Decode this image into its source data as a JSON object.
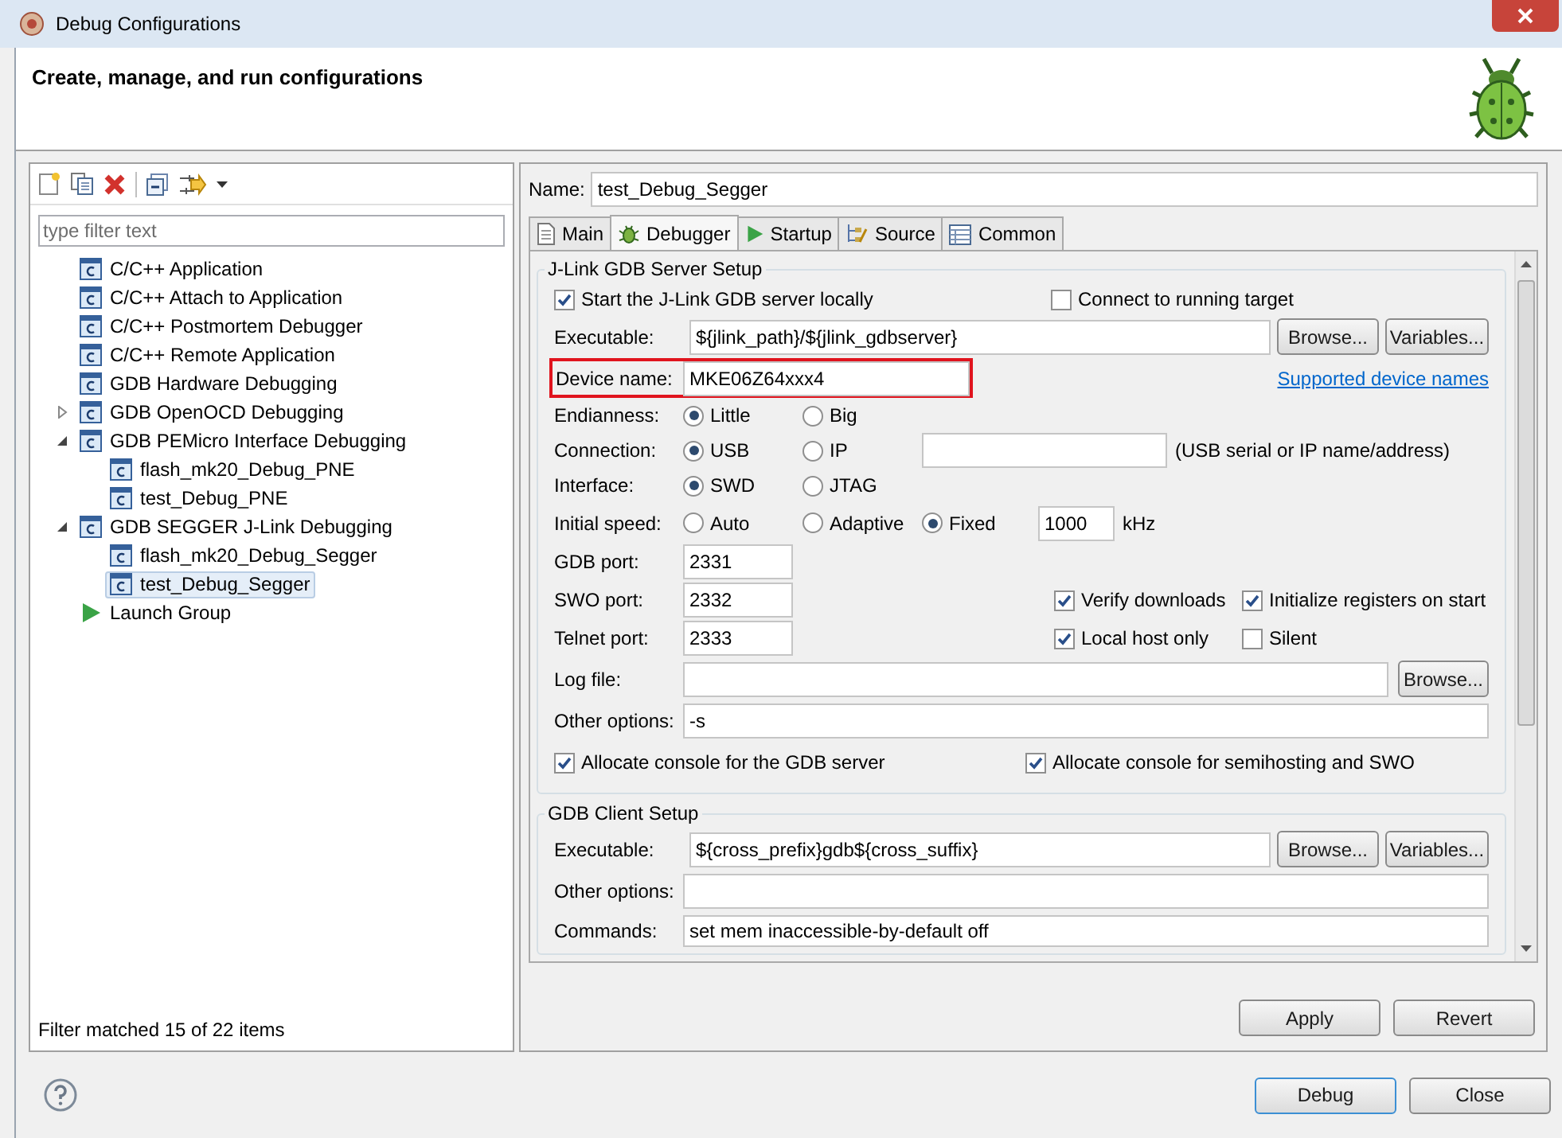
{
  "window": {
    "title": "Debug Configurations"
  },
  "header": {
    "title": "Create, manage, and run configurations"
  },
  "filter": {
    "placeholder": "type filter text"
  },
  "tree": [
    {
      "label": "C/C++ Application",
      "kind": "config",
      "selected": false
    },
    {
      "label": "C/C++ Attach to Application",
      "kind": "config",
      "selected": false
    },
    {
      "label": "C/C++ Postmortem Debugger",
      "kind": "config",
      "selected": false
    },
    {
      "label": "C/C++ Remote Application",
      "kind": "config",
      "selected": false
    },
    {
      "label": "GDB Hardware Debugging",
      "kind": "config",
      "selected": false
    },
    {
      "label": "GDB OpenOCD Debugging",
      "kind": "config",
      "selected": false,
      "expanded": false
    },
    {
      "label": "GDB PEMicro Interface Debugging",
      "kind": "config",
      "selected": false,
      "expanded": true,
      "children": [
        {
          "label": "flash_mk20_Debug_PNE",
          "kind": "config",
          "selected": false
        },
        {
          "label": "test_Debug_PNE",
          "kind": "config",
          "selected": false
        }
      ]
    },
    {
      "label": "GDB SEGGER J-Link Debugging",
      "kind": "config",
      "selected": false,
      "expanded": true,
      "children": [
        {
          "label": "flash_mk20_Debug_Segger",
          "kind": "config",
          "selected": false
        },
        {
          "label": "test_Debug_Segger",
          "kind": "config",
          "selected": true
        }
      ]
    },
    {
      "label": "Launch Group",
      "kind": "launch",
      "selected": false
    }
  ],
  "filter_status": "Filter matched 15 of 22 items",
  "name": {
    "label": "Name:",
    "value": "test_Debug_Segger"
  },
  "tabs": [
    {
      "label": "Main",
      "kind": "doc",
      "selected": false
    },
    {
      "label": "Debugger",
      "kind": "bug",
      "selected": true
    },
    {
      "label": "Startup",
      "kind": "play",
      "selected": false
    },
    {
      "label": "Source",
      "kind": "source",
      "selected": false
    },
    {
      "label": "Common",
      "kind": "table",
      "selected": false
    }
  ],
  "server": {
    "title": "J-Link GDB Server Setup",
    "start_locally": {
      "label": "Start the J-Link GDB server locally",
      "checked": true
    },
    "connect_running": {
      "label": "Connect to running target",
      "checked": false
    },
    "executable": {
      "label": "Executable:",
      "value": "${jlink_path}/${jlink_gdbserver}",
      "buttons": [
        "Browse...",
        "Variables..."
      ]
    },
    "device": {
      "label": "Device name:",
      "value": "MKE06Z64xxx4",
      "highlighted": true,
      "link": "Supported device names"
    },
    "radios": [
      {
        "label": "Endianness:",
        "kind": "plain",
        "options": [
          {
            "label": "Little",
            "selected": true
          },
          {
            "label": "Big",
            "selected": false
          }
        ]
      },
      {
        "label": "Connection:",
        "kind": "field",
        "options": [
          {
            "label": "USB",
            "selected": true
          },
          {
            "label": "IP",
            "selected": false
          }
        ],
        "hint": "(USB serial or IP name/address)"
      },
      {
        "label": "Interface:",
        "kind": "plain",
        "options": [
          {
            "label": "SWD",
            "selected": true
          },
          {
            "label": "JTAG",
            "selected": false
          }
        ]
      },
      {
        "label": "Initial speed:",
        "kind": "field",
        "options": [
          {
            "label": "Auto",
            "selected": false
          },
          {
            "label": "Adaptive",
            "selected": false
          },
          {
            "label": "Fixed",
            "selected": true
          }
        ],
        "field": "1000",
        "hint": "kHz"
      }
    ],
    "ports": [
      {
        "label": "GDB port:",
        "value": "2331"
      },
      {
        "label": "SWO port:",
        "value": "2332",
        "checks": [
          {
            "label": "Verify downloads",
            "checked": true
          },
          {
            "label": "Initialize registers on start",
            "checked": true
          }
        ]
      },
      {
        "label": "Telnet port:",
        "value": "2333",
        "checks": [
          {
            "label": "Local host only",
            "checked": true
          },
          {
            "label": "Silent",
            "checked": false
          }
        ]
      }
    ],
    "log_file": {
      "label": "Log file:",
      "button": "Browse..."
    },
    "other_options": {
      "label": "Other options:",
      "value": "-s"
    },
    "consoles": [
      {
        "label": "Allocate console for the GDB server",
        "checked": true
      },
      {
        "label": "Allocate console for semihosting and SWO",
        "checked": true
      }
    ]
  },
  "client": {
    "title": "GDB Client Setup",
    "executable": {
      "label": "Executable:",
      "value": "${cross_prefix}gdb${cross_suffix}",
      "buttons": [
        "Browse...",
        "Variables..."
      ]
    },
    "other_options": {
      "label": "Other options:"
    },
    "commands": {
      "label": "Commands:",
      "value": "set mem inaccessible-by-default off"
    }
  },
  "panel_buttons": [
    "Apply",
    "Revert"
  ],
  "dialog_buttons": [
    {
      "label": "Debug",
      "default": true
    },
    {
      "label": "Close",
      "default": false
    }
  ]
}
